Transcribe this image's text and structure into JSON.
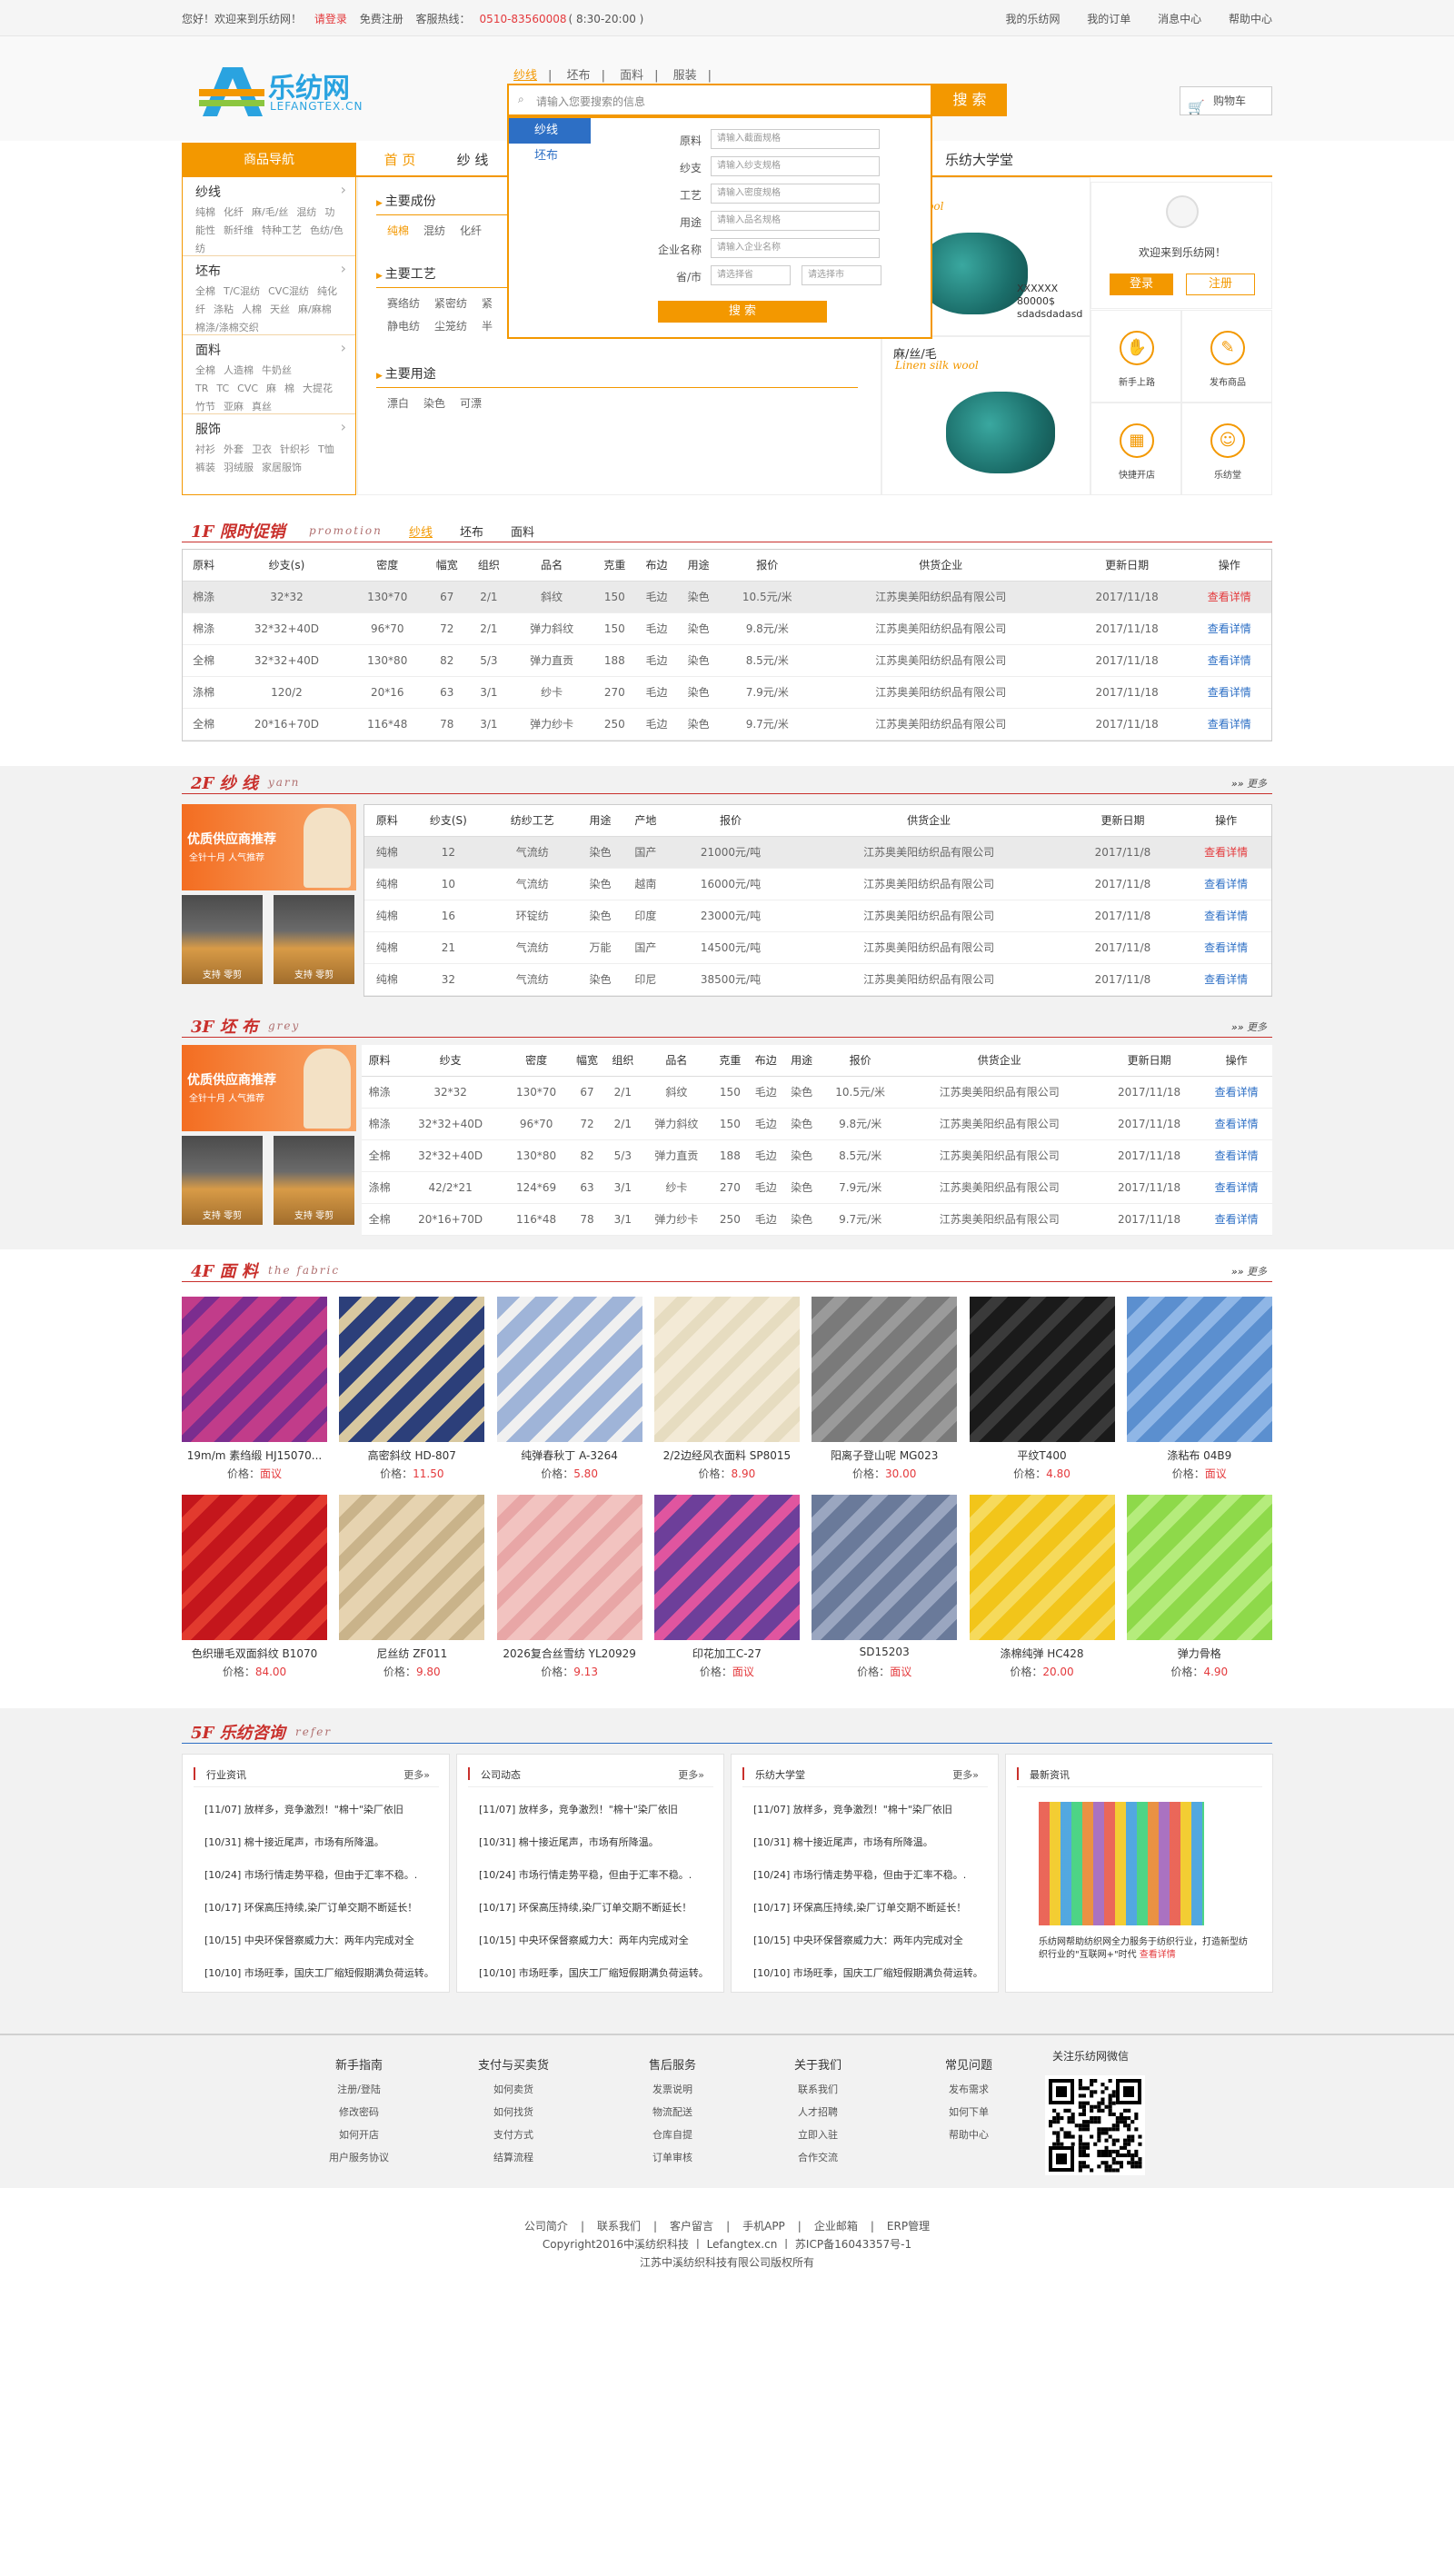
{
  "topbar": {
    "welcome": "您好！欢迎来到乐纺网！",
    "login": "请登录",
    "register": "免费注册",
    "hotline_label": "客服热线：",
    "hotline": "0510-83560008",
    "hotline_hours": "( 8:30-20:00 )",
    "links": [
      "我的乐纺网",
      "我的订单",
      "消息中心",
      "帮助中心"
    ]
  },
  "logo": {
    "name": "乐纺网",
    "domain": "LEFANGTEX.CN"
  },
  "search": {
    "tabs": [
      "纱线",
      "坯布",
      "面料",
      "服装"
    ],
    "placeholder": "请输入您要搜索的信息",
    "button": "搜 索"
  },
  "cart": {
    "label": "购物车"
  },
  "nav": {
    "category": "商品导航",
    "items": [
      "首 页",
      "纱 线",
      "",
      "",
      "",
      "",
      "",
      ""
    ],
    "university": "乐纺大学堂"
  },
  "categories": [
    {
      "title": "纱线",
      "subs": [
        "纯棉",
        "化纤",
        "麻/毛/丝",
        "混纺",
        "功能性",
        "新纤维",
        "特种工艺",
        "色纺/色纺"
      ]
    },
    {
      "title": "坯布",
      "subs": [
        "全棉",
        "T/C混纺",
        "CVC混纺",
        "纯化纤",
        "涤粘",
        "人棉",
        "天丝",
        "麻/麻棉",
        "棉涤/涤棉交织"
      ]
    },
    {
      "title": "面料",
      "subs": [
        "全棉",
        "人造棉",
        "牛奶丝",
        "TR",
        "TC",
        "CVC",
        "麻",
        "棉",
        "大提花",
        "竹节",
        "亚麻",
        "真丝"
      ]
    },
    {
      "title": "服饰",
      "subs": [
        "衬衫",
        "外套",
        "卫衣",
        "针织衫",
        "T恤",
        "裤装",
        "羽绒服",
        "家居服饰"
      ]
    }
  ],
  "mid": {
    "g1": {
      "title": "主要成份",
      "items": [
        "纯棉",
        "混纺",
        "化纤"
      ]
    },
    "g2": {
      "title": "主要工艺",
      "items": [
        "赛络纺",
        "紧密纺",
        "紧"
      ],
      "items2": [
        "静电纺",
        "尘笼纺",
        "半"
      ]
    },
    "g3": {
      "title": "主要用途",
      "items": [
        "漂白",
        "染色",
        "可漂"
      ]
    }
  },
  "dropdown": {
    "tabs": [
      "纱线",
      "坯布"
    ],
    "rows": [
      {
        "label": "原料",
        "ph": "请输入截面规格"
      },
      {
        "label": "纱支",
        "ph": "请输入纱支规格"
      },
      {
        "label": "工艺",
        "ph": "请输入密度规格"
      },
      {
        "label": "用途",
        "ph": "请输入品名规格"
      },
      {
        "label": "企业名称",
        "ph": "请输入企业名称"
      }
    ],
    "region_label": "省/市",
    "province_ph": "请选择省",
    "city_ph": "请选择市",
    "button": "搜 索"
  },
  "banners": [
    {
      "title": "/毛",
      "en": "silk wool",
      "price_lines": [
        "XXXXXX",
        "80000$",
        "sdadsdadasd"
      ]
    },
    {
      "title": "麻/丝/毛",
      "en": "Linen silk wool"
    }
  ],
  "user": {
    "welcome": "欢迎来到乐纺网！",
    "login": "登录",
    "register": "注册",
    "quick": [
      {
        "icon": "✋",
        "label": "新手上路"
      },
      {
        "icon": "✎",
        "label": "发布商品"
      },
      {
        "icon": "▦",
        "label": "快捷开店"
      },
      {
        "icon": "☺",
        "label": "乐纺堂"
      }
    ]
  },
  "floor1": {
    "num": "1F",
    "title": "限时促销",
    "en": "promotion",
    "tabs": [
      "纱线",
      "坯布",
      "面料"
    ],
    "headers": [
      "原料",
      "纱支(s)",
      "密度",
      "幅宽",
      "组织",
      "品名",
      "克重",
      "布边",
      "用途",
      "报价",
      "供货企业",
      "更新日期",
      "操作"
    ],
    "rows": [
      [
        "棉涤",
        "32*32",
        "130*70",
        "67",
        "2/1",
        "斜纹",
        "150",
        "毛边",
        "染色",
        "10.5元/米",
        "江苏奥美阳纺织品有限公司",
        "2017/11/18",
        "查看详情"
      ],
      [
        "棉涤",
        "32*32+40D",
        "96*70",
        "72",
        "2/1",
        "弹力斜纹",
        "150",
        "毛边",
        "染色",
        "9.8元/米",
        "江苏奥美阳纺织品有限公司",
        "2017/11/18",
        "查看详情"
      ],
      [
        "全棉",
        "32*32+40D",
        "130*80",
        "82",
        "5/3",
        "弹力直贡",
        "188",
        "毛边",
        "染色",
        "8.5元/米",
        "江苏奥美阳纺织品有限公司",
        "2017/11/18",
        "查看详情"
      ],
      [
        "涤棉",
        "120/2",
        "20*16",
        "63",
        "3/1",
        "纱卡",
        "270",
        "毛边",
        "染色",
        "7.9元/米",
        "江苏奥美阳纺织品有限公司",
        "2017/11/18",
        "查看详情"
      ],
      [
        "全棉",
        "20*16+70D",
        "116*48",
        "78",
        "3/1",
        "弹力纱卡",
        "250",
        "毛边",
        "染色",
        "9.7元/米",
        "江苏奥美阳纺织品有限公司",
        "2017/11/18",
        "查看详情"
      ]
    ]
  },
  "floor2": {
    "num": "2F",
    "title": "纱 线",
    "en": "yarn",
    "more": "更多",
    "promo": {
      "title": "优质供应商推荐",
      "sub": "全针十月 人气推荐",
      "small": "支持 零剪"
    },
    "headers": [
      "原料",
      "纱支(S)",
      "纺纱工艺",
      "用途",
      "产地",
      "报价",
      "供货企业",
      "更新日期",
      "操作"
    ],
    "rows": [
      [
        "纯棉",
        "12",
        "气流纺",
        "染色",
        "国产",
        "21000元/吨",
        "江苏奥美阳纺织品有限公司",
        "2017/11/8",
        "查看详情"
      ],
      [
        "纯棉",
        "10",
        "气流纺",
        "染色",
        "越南",
        "16000元/吨",
        "江苏奥美阳纺织品有限公司",
        "2017/11/8",
        "查看详情"
      ],
      [
        "纯棉",
        "16",
        "环锭纺",
        "染色",
        "印度",
        "23000元/吨",
        "江苏奥美阳纺织品有限公司",
        "2017/11/8",
        "查看详情"
      ],
      [
        "纯棉",
        "21",
        "气流纺",
        "万能",
        "国产",
        "14500元/吨",
        "江苏奥美阳纺织品有限公司",
        "2017/11/8",
        "查看详情"
      ],
      [
        "纯棉",
        "32",
        "气流纺",
        "染色",
        "印尼",
        "38500元/吨",
        "江苏奥美阳纺织品有限公司",
        "2017/11/8",
        "查看详情"
      ]
    ]
  },
  "floor3": {
    "num": "3F",
    "title": "坯 布",
    "en": "grey",
    "more": "更多",
    "headers": [
      "原料",
      "纱支",
      "密度",
      "幅宽",
      "组织",
      "品名",
      "克重",
      "布边",
      "用途",
      "报价",
      "供货企业",
      "更新日期",
      "操作"
    ],
    "rows": [
      [
        "棉涤",
        "32*32",
        "130*70",
        "67",
        "2/1",
        "斜纹",
        "150",
        "毛边",
        "染色",
        "10.5元/米",
        "江苏奥美阳织品有限公司",
        "2017/11/18",
        "查看详情"
      ],
      [
        "棉涤",
        "32*32+40D",
        "96*70",
        "72",
        "2/1",
        "弹力斜纹",
        "150",
        "毛边",
        "染色",
        "9.8元/米",
        "江苏奥美阳织品有限公司",
        "2017/11/18",
        "查看详情"
      ],
      [
        "全棉",
        "32*32+40D",
        "130*80",
        "82",
        "5/3",
        "弹力直贡",
        "188",
        "毛边",
        "染色",
        "8.5元/米",
        "江苏奥美阳织品有限公司",
        "2017/11/18",
        "查看详情"
      ],
      [
        "涤棉",
        "42/2*21",
        "124*69",
        "63",
        "3/1",
        "纱卡",
        "270",
        "毛边",
        "染色",
        "7.9元/米",
        "江苏奥美阳织品有限公司",
        "2017/11/18",
        "查看详情"
      ],
      [
        "全棉",
        "20*16+70D",
        "116*48",
        "78",
        "3/1",
        "弹力纱卡",
        "250",
        "毛边",
        "染色",
        "9.7元/米",
        "江苏奥美阳织品有限公司",
        "2017/11/18",
        "查看详情"
      ]
    ]
  },
  "floor4": {
    "num": "4F",
    "title": "面 料",
    "en": "the fabric",
    "more": "更多",
    "price_label": "价格：",
    "products": [
      {
        "name": "19m/m 素绉缎 HJ15070...",
        "price": "面议",
        "c1": "#c13c8a",
        "c2": "#7b2d8f"
      },
      {
        "name": "高密斜纹 HD-807",
        "price": "11.50",
        "c1": "#2c3f7a",
        "c2": "#d8c8a0"
      },
      {
        "name": "纯弹春秋丁 A-3264",
        "price": "5.80",
        "c1": "#9fb4d8",
        "c2": "#f0f0f0"
      },
      {
        "name": "2/2边经风衣面料 SP8015",
        "price": "8.90",
        "c1": "#f3ead6",
        "c2": "#e6dcc0"
      },
      {
        "name": "阳离子登山呢 MG023",
        "price": "30.00",
        "c1": "#7a7a7a",
        "c2": "#9a9a9a"
      },
      {
        "name": "平纹T400",
        "price": "4.80",
        "c1": "#1a1a1a",
        "c2": "#3a3a3a"
      },
      {
        "name": "涤粘布 04B9",
        "price": "面议",
        "c1": "#5b8fcf",
        "c2": "#8fb6e6"
      },
      {
        "name": "色织珊毛双面斜纹 B1070",
        "price": "84.00",
        "c1": "#c4161c",
        "c2": "#e23a2e"
      },
      {
        "name": "尼丝纺 ZF011",
        "price": "9.80",
        "c1": "#e6d3b0",
        "c2": "#c9b38a"
      },
      {
        "name": "2026复合丝雪纺 YL20929",
        "price": "9.13",
        "c1": "#f2c3c0",
        "c2": "#e8a6a6"
      },
      {
        "name": "印花加工C-27",
        "price": "面议",
        "c1": "#6d3f9a",
        "c2": "#e0559f"
      },
      {
        "name": "SD15203",
        "price": "面议",
        "c1": "#6a7a9a",
        "c2": "#9aa6c0"
      },
      {
        "name": "涤棉纯弹 HC428",
        "price": "20.00",
        "c1": "#f2c51a",
        "c2": "#f6da5c"
      },
      {
        "name": "弹力骨格",
        "price": "4.90",
        "c1": "#8ed94a",
        "c2": "#b5ec7c"
      }
    ]
  },
  "floor5": {
    "num": "5F",
    "title": "乐纺咨询",
    "en": "refer",
    "more": "更多",
    "boxes": [
      {
        "title": "行业资讯",
        "items": [
          "[11/07] 放样多，竞争激烈！\"棉十\"染厂依旧",
          "[10/31] 棉十接近尾声，市场有所降温。",
          "[10/24] 市场行情走势平稳，但由于汇率不稳。.",
          "[10/17] 环保高压持续,染厂订单交期不断延长！",
          "[10/15] 中央环保督察威力大：两年内完成对全",
          "[10/10] 市场旺季，国庆工厂缩短假期满负荷运转。"
        ]
      },
      {
        "title": "公司动态",
        "items": [
          "[11/07] 放样多，竞争激烈！\"棉十\"染厂依旧",
          "[10/31] 棉十接近尾声，市场有所降温。",
          "[10/24] 市场行情走势平稳，但由于汇率不稳。.",
          "[10/17] 环保高压持续,染厂订单交期不断延长！",
          "[10/15] 中央环保督察威力大：两年内完成对全",
          "[10/10] 市场旺季，国庆工厂缩短假期满负荷运转。"
        ]
      },
      {
        "title": "乐纺大学堂",
        "items": [
          "[11/07] 放样多，竞争激烈！\"棉十\"染厂依旧",
          "[10/31] 棉十接近尾声，市场有所降温。",
          "[10/24] 市场行情走势平稳，但由于汇率不稳。.",
          "[10/17] 环保高压持续,染厂订单交期不断延长！",
          "[10/15] 中央环保督察威力大：两年内完成对全",
          "[10/10] 市场旺季，国庆工厂缩短假期满负荷运转。"
        ]
      }
    ],
    "latest": {
      "title": "最新资讯",
      "text": "乐纺网帮助纺织网全力服务于纺织行业，打造新型纺织行业的\"互联网+\"时代",
      "link": "查看详情"
    }
  },
  "footer": {
    "cols": [
      {
        "title": "新手指南",
        "items": [
          "注册/登陆",
          "修改密码",
          "如何开店",
          "用户服务协议"
        ]
      },
      {
        "title": "支付与买卖货",
        "items": [
          "如何卖货",
          "如何找货",
          "支付方式",
          "结算流程"
        ]
      },
      {
        "title": "售后服务",
        "items": [
          "发票说明",
          "物流配送",
          "仓库自提",
          "订单审核"
        ]
      },
      {
        "title": "关于我们",
        "items": [
          "联系我们",
          "人才招聘",
          "立即入驻",
          "合作交流"
        ]
      },
      {
        "title": "常见问题",
        "items": [
          "发布需求",
          "如何下单",
          "帮助中心"
        ]
      }
    ],
    "qr_title": "关注乐纺网微信",
    "bottom_links": [
      "公司简介",
      "联系我们",
      "客户留言",
      "手机APP",
      "企业邮箱",
      "ERP管理"
    ],
    "copyright": "Copyright2016中溪纺织科技 丨 Lefangtex.cn 丨 苏ICP备16043357号-1",
    "company": "江苏中溪纺织科技有限公司版权所有"
  }
}
